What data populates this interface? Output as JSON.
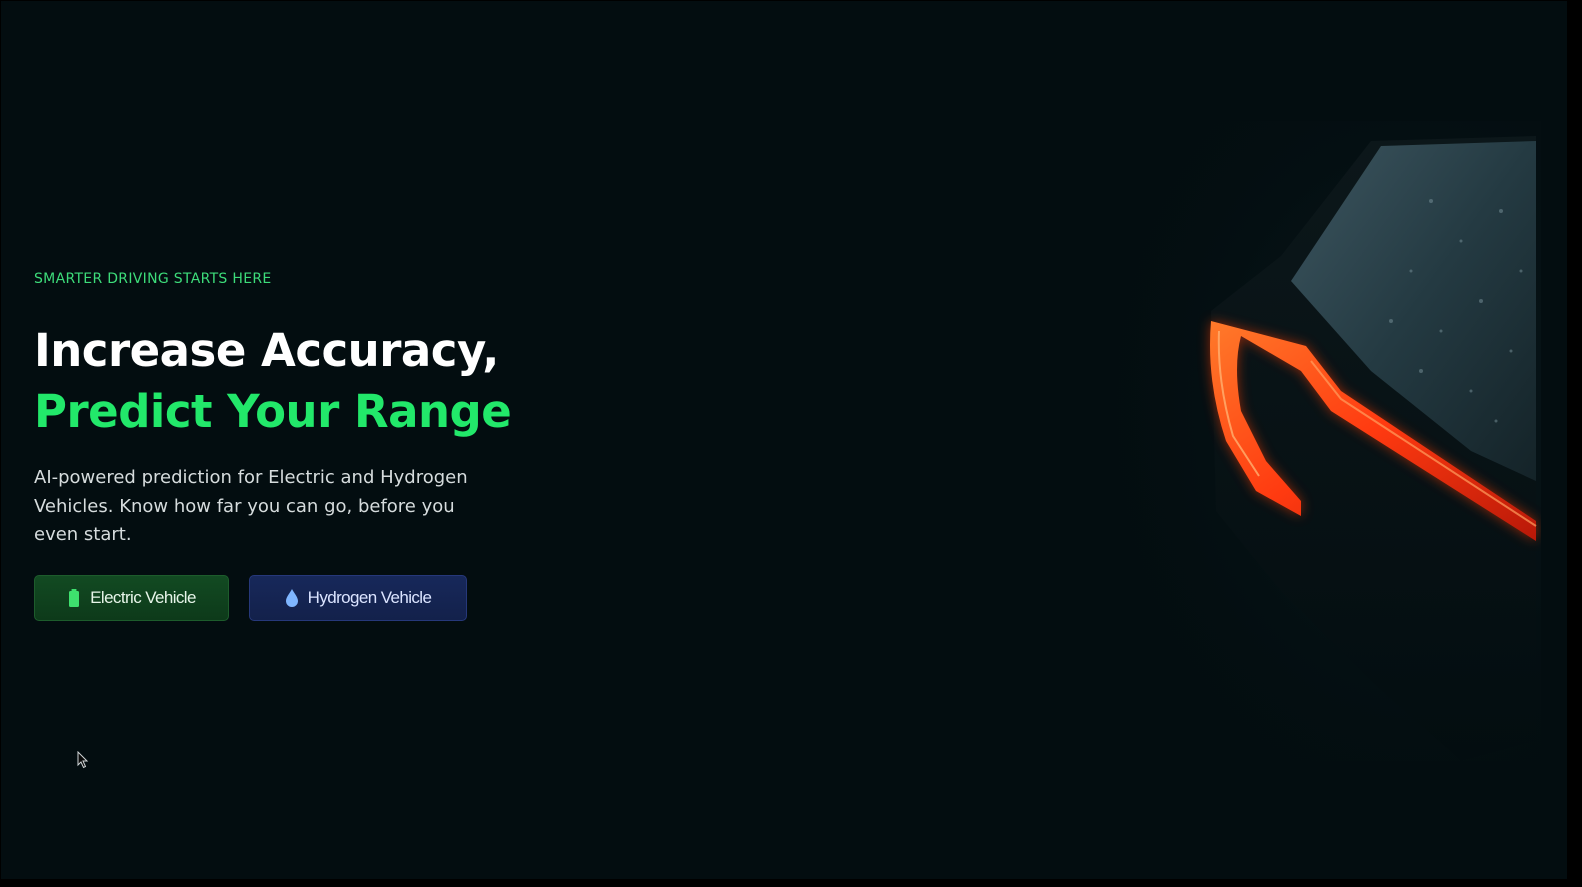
{
  "hero": {
    "eyebrow": "SMARTER DRIVING STARTS HERE",
    "headline_line1": "Increase Accuracy,",
    "headline_line2": "Predict Your Range",
    "description": "AI-powered prediction for Electric and Hydrogen Vehicles. Know how far you can go, before you even start."
  },
  "buttons": {
    "electric": {
      "label": "Electric Vehicle",
      "icon": "battery-icon"
    },
    "hydrogen": {
      "label": "Hydrogen Vehicle",
      "icon": "water-drop-icon"
    }
  },
  "colors": {
    "background": "#030d10",
    "accent_green": "#22e86a",
    "eyebrow_green": "#3ddc7a",
    "ev_button": "#124a22",
    "hydrogen_button": "#17285a",
    "tail_light": "#ff4a1a"
  },
  "images": {
    "hero_image": "car-tail-light-image"
  }
}
